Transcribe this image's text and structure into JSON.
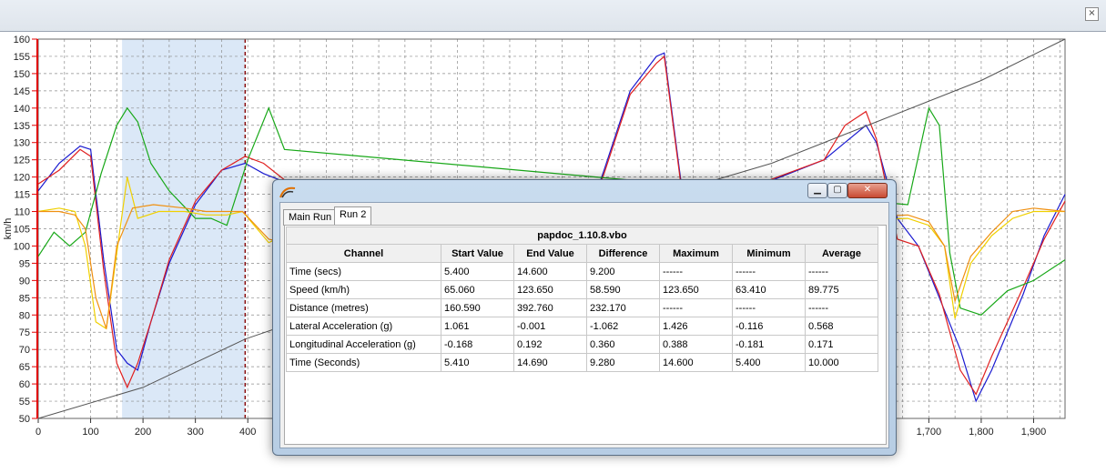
{
  "window": {
    "close_glyph": "×"
  },
  "chart_data": {
    "type": "line",
    "ylabel": "km/h",
    "xlabel": "",
    "ylim": [
      50,
      160
    ],
    "xlim": [
      0,
      1960
    ],
    "y_ticks": [
      50,
      55,
      60,
      65,
      70,
      75,
      80,
      85,
      90,
      95,
      100,
      105,
      110,
      115,
      120,
      125,
      130,
      135,
      140,
      145,
      150,
      155,
      160
    ],
    "x_ticks": [
      0,
      100,
      200,
      300,
      400,
      1700,
      1800,
      1900
    ],
    "x_tick_labels": [
      "0",
      "100",
      "200",
      "300",
      "400",
      "1,700",
      "1,800",
      "1,900"
    ],
    "grid": true,
    "selection_range": [
      160,
      395
    ],
    "colors": {
      "blue": "#1a1ad0",
      "red": "#e02020",
      "green": "#18a818",
      "yellow": "#f0d000",
      "orange": "#f09010",
      "gray": "#555555",
      "axis": "#e00000"
    },
    "series": [
      {
        "color": "blue",
        "points": [
          [
            0,
            116
          ],
          [
            40,
            124
          ],
          [
            80,
            129
          ],
          [
            100,
            128
          ],
          [
            125,
            96
          ],
          [
            150,
            70
          ],
          [
            170,
            66
          ],
          [
            190,
            64
          ],
          [
            215,
            78
          ],
          [
            250,
            95
          ],
          [
            300,
            112
          ],
          [
            350,
            122
          ],
          [
            395,
            124
          ],
          [
            430,
            121
          ],
          [
            480,
            118
          ],
          [
            1030,
            100
          ],
          [
            1080,
            122
          ],
          [
            1130,
            145
          ],
          [
            1180,
            155
          ],
          [
            1195,
            156
          ],
          [
            1230,
            115
          ],
          [
            1250,
            110
          ],
          [
            1500,
            125
          ],
          [
            1540,
            130
          ],
          [
            1580,
            135
          ],
          [
            1600,
            130
          ],
          [
            1640,
            108
          ],
          [
            1680,
            100
          ],
          [
            1720,
            85
          ],
          [
            1760,
            70
          ],
          [
            1790,
            55
          ],
          [
            1820,
            64
          ],
          [
            1880,
            86
          ],
          [
            1920,
            103
          ],
          [
            1960,
            115
          ]
        ]
      },
      {
        "color": "red",
        "points": [
          [
            0,
            118
          ],
          [
            40,
            122
          ],
          [
            80,
            128
          ],
          [
            100,
            126
          ],
          [
            125,
            93
          ],
          [
            150,
            66
          ],
          [
            170,
            59
          ],
          [
            190,
            66
          ],
          [
            215,
            78
          ],
          [
            250,
            96
          ],
          [
            300,
            113
          ],
          [
            350,
            122
          ],
          [
            395,
            126
          ],
          [
            430,
            124
          ],
          [
            480,
            118
          ],
          [
            1030,
            100
          ],
          [
            1080,
            121
          ],
          [
            1130,
            144
          ],
          [
            1180,
            153
          ],
          [
            1195,
            155
          ],
          [
            1230,
            114
          ],
          [
            1250,
            111
          ],
          [
            1500,
            125
          ],
          [
            1540,
            135
          ],
          [
            1580,
            139
          ],
          [
            1600,
            131
          ],
          [
            1640,
            102
          ],
          [
            1680,
            100
          ],
          [
            1720,
            86
          ],
          [
            1760,
            64
          ],
          [
            1790,
            57
          ],
          [
            1820,
            68
          ],
          [
            1880,
            88
          ],
          [
            1920,
            102
          ],
          [
            1960,
            113
          ]
        ]
      },
      {
        "color": "green",
        "points": [
          [
            0,
            97
          ],
          [
            30,
            104
          ],
          [
            60,
            100
          ],
          [
            90,
            104
          ],
          [
            120,
            121
          ],
          [
            150,
            135
          ],
          [
            170,
            140
          ],
          [
            190,
            136
          ],
          [
            215,
            124
          ],
          [
            250,
            116
          ],
          [
            300,
            108
          ],
          [
            330,
            108
          ],
          [
            360,
            106
          ],
          [
            400,
            125
          ],
          [
            440,
            140
          ],
          [
            470,
            128
          ],
          [
            1660,
            112
          ],
          [
            1700,
            140
          ],
          [
            1720,
            135
          ],
          [
            1740,
            98
          ],
          [
            1760,
            82
          ],
          [
            1800,
            80
          ],
          [
            1850,
            87
          ],
          [
            1900,
            90
          ],
          [
            1960,
            96
          ]
        ]
      },
      {
        "color": "yellow",
        "points": [
          [
            0,
            110
          ],
          [
            40,
            111
          ],
          [
            70,
            110
          ],
          [
            90,
            100
          ],
          [
            110,
            78
          ],
          [
            130,
            76
          ],
          [
            150,
            98
          ],
          [
            170,
            120
          ],
          [
            190,
            108
          ],
          [
            230,
            110
          ],
          [
            280,
            110
          ],
          [
            320,
            109
          ],
          [
            360,
            109
          ],
          [
            390,
            110
          ],
          [
            440,
            101
          ],
          [
            470,
            103
          ],
          [
            1660,
            108
          ],
          [
            1700,
            106
          ],
          [
            1730,
            100
          ],
          [
            1750,
            79
          ],
          [
            1780,
            95
          ],
          [
            1820,
            103
          ],
          [
            1860,
            108
          ],
          [
            1900,
            110
          ],
          [
            1960,
            110
          ]
        ]
      },
      {
        "color": "orange",
        "points": [
          [
            0,
            110
          ],
          [
            40,
            110
          ],
          [
            70,
            109
          ],
          [
            90,
            105
          ],
          [
            110,
            85
          ],
          [
            130,
            76
          ],
          [
            150,
            100
          ],
          [
            180,
            111
          ],
          [
            220,
            112
          ],
          [
            280,
            111
          ],
          [
            320,
            110
          ],
          [
            360,
            110
          ],
          [
            390,
            110
          ],
          [
            440,
            102
          ],
          [
            470,
            101
          ],
          [
            1660,
            109
          ],
          [
            1700,
            107
          ],
          [
            1730,
            100
          ],
          [
            1750,
            84
          ],
          [
            1780,
            97
          ],
          [
            1820,
            104
          ],
          [
            1860,
            110
          ],
          [
            1900,
            111
          ],
          [
            1960,
            110
          ]
        ]
      },
      {
        "color": "gray",
        "points": [
          [
            0,
            50
          ],
          [
            200,
            59
          ],
          [
            395,
            73
          ],
          [
            1200,
            115
          ],
          [
            1400,
            124
          ],
          [
            1600,
            136
          ],
          [
            1800,
            148
          ],
          [
            1960,
            160
          ]
        ]
      }
    ]
  },
  "popup": {
    "tabs": [
      {
        "label": "Main Run"
      },
      {
        "label": "Run 2"
      }
    ],
    "file": "papdoc_1.10.8.vbo",
    "columns": [
      "Channel",
      "Start Value",
      "End Value",
      "Difference",
      "Maximum",
      "Minimum",
      "Average"
    ],
    "rows": [
      [
        "Time (secs)",
        "5.400",
        "14.600",
        "9.200",
        "------",
        "------",
        "------"
      ],
      [
        "Speed (km/h)",
        "65.060",
        "123.650",
        "58.590",
        "123.650",
        "63.410",
        "89.775"
      ],
      [
        "Distance (metres)",
        "160.590",
        "392.760",
        "232.170",
        "------",
        "------",
        "------"
      ],
      [
        "Lateral Acceleration (g)",
        "1.061",
        "-0.001",
        "-1.062",
        "1.426",
        "-0.116",
        "0.568"
      ],
      [
        "Longitudinal Acceleration (g)",
        "-0.168",
        "0.192",
        "0.360",
        "0.388",
        "-0.181",
        "0.171"
      ],
      [
        "Time (Seconds)",
        "5.410",
        "14.690",
        "9.280",
        "14.600",
        "5.400",
        "10.000"
      ]
    ]
  }
}
